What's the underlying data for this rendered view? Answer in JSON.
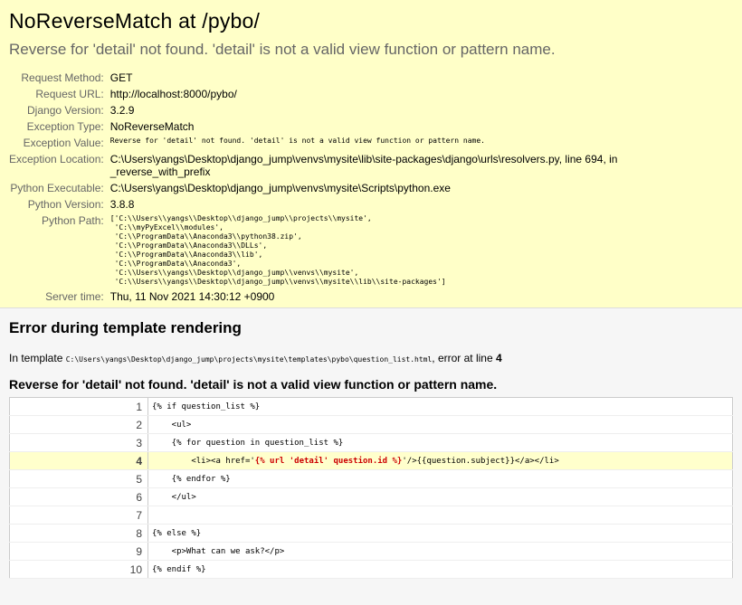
{
  "summary": {
    "title": "NoReverseMatch at /pybo/",
    "subtitle": "Reverse for 'detail' not found. 'detail' is not a valid view function or pattern name.",
    "rows": [
      {
        "label": "Request Method:",
        "value": "GET"
      },
      {
        "label": "Request URL:",
        "value": "http://localhost:8000/pybo/"
      },
      {
        "label": "Django Version:",
        "value": "3.2.9"
      },
      {
        "label": "Exception Type:",
        "value": "NoReverseMatch"
      },
      {
        "label": "Exception Value:",
        "value": "Reverse for 'detail' not found. 'detail' is not a valid view function or pattern name."
      },
      {
        "label": "Exception Location:",
        "value": "C:\\Users\\yangs\\Desktop\\django_jump\\venvs\\mysite\\lib\\site-packages\\django\\urls\\resolvers.py, line 694, in _reverse_with_prefix"
      },
      {
        "label": "Python Executable:",
        "value": "C:\\Users\\yangs\\Desktop\\django_jump\\venvs\\mysite\\Scripts\\python.exe"
      },
      {
        "label": "Python Version:",
        "value": "3.8.8"
      },
      {
        "label": "Python Path:",
        "value": "['C:\\\\Users\\\\yangs\\\\Desktop\\\\django_jump\\\\projects\\\\mysite',\n 'C:\\\\myPyExcel\\\\modules',\n 'C:\\\\ProgramData\\\\Anaconda3\\\\python38.zip',\n 'C:\\\\ProgramData\\\\Anaconda3\\\\DLLs',\n 'C:\\\\ProgramData\\\\Anaconda3\\\\lib',\n 'C:\\\\ProgramData\\\\Anaconda3',\n 'C:\\\\Users\\\\yangs\\\\Desktop\\\\django_jump\\\\venvs\\\\mysite',\n 'C:\\\\Users\\\\yangs\\\\Desktop\\\\django_jump\\\\venvs\\\\mysite\\\\lib\\\\site-packages']"
      },
      {
        "label": "Server time:",
        "value": "Thu, 11 Nov 2021 14:30:12 +0900"
      }
    ]
  },
  "template": {
    "heading": "Error during template rendering",
    "in_template_prefix": "In template",
    "template_path": "C:\\Users\\yangs\\Desktop\\django_jump\\projects\\mysite\\templates\\pybo\\question_list.html",
    "error_at_line_text": ", error at line",
    "error_line": "4",
    "message": "Reverse for 'detail' not found. 'detail' is not a valid view function or pattern name.",
    "source_lines": [
      {
        "num": "1",
        "code": "{% if question_list %}"
      },
      {
        "num": "2",
        "code": "    <ul>"
      },
      {
        "num": "3",
        "code": "    {% for question in question_list %}"
      },
      {
        "num": "4",
        "before": "        <li><a href='",
        "specific": "{% url 'detail' question.id %}",
        "after": "'/>{{question.subject}}</a></li>"
      },
      {
        "num": "5",
        "code": "    {% endfor %}"
      },
      {
        "num": "6",
        "code": "    </ul>"
      },
      {
        "num": "7",
        "code": ""
      },
      {
        "num": "8",
        "code": "{% else %}"
      },
      {
        "num": "9",
        "code": "    <p>What can we ask?</p>"
      },
      {
        "num": "10",
        "code": "{% endif %}"
      }
    ]
  }
}
